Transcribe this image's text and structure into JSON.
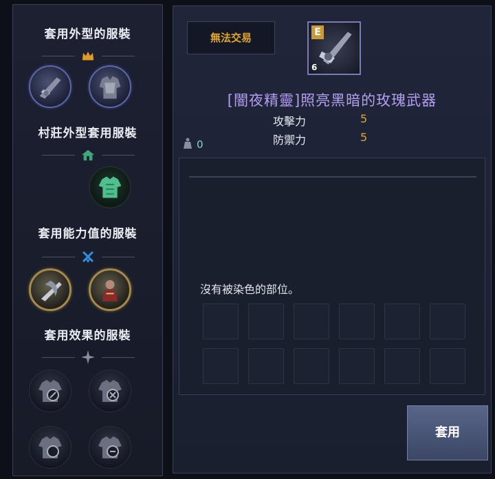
{
  "left_panel": {
    "sections": [
      {
        "title": "套用外型的服裝",
        "icon": "crown-icon",
        "icon_color": "#e09a2a"
      },
      {
        "title": "村莊外型套用服裝",
        "icon": "house-icon",
        "icon_color": "#3fa57a"
      },
      {
        "title": "套用能力值的服裝",
        "icon": "crossed-swords-icon",
        "icon_color": "#2f8fe0"
      },
      {
        "title": "套用效果的服裝",
        "icon": "sparkle-icon",
        "icon_color": "#8a8fa0"
      }
    ]
  },
  "item": {
    "trade_status": "無法交易",
    "grade": "E",
    "level": "6",
    "name": "[闇夜精靈]照亮黑暗的玫瑰武器",
    "stats": [
      {
        "label": "攻擊力",
        "value": "5"
      },
      {
        "label": "防禦力",
        "value": "5"
      }
    ],
    "weight": "0"
  },
  "dye": {
    "message": "沒有被染色的部位。",
    "slot_count": 12
  },
  "apply_button": "套用"
}
